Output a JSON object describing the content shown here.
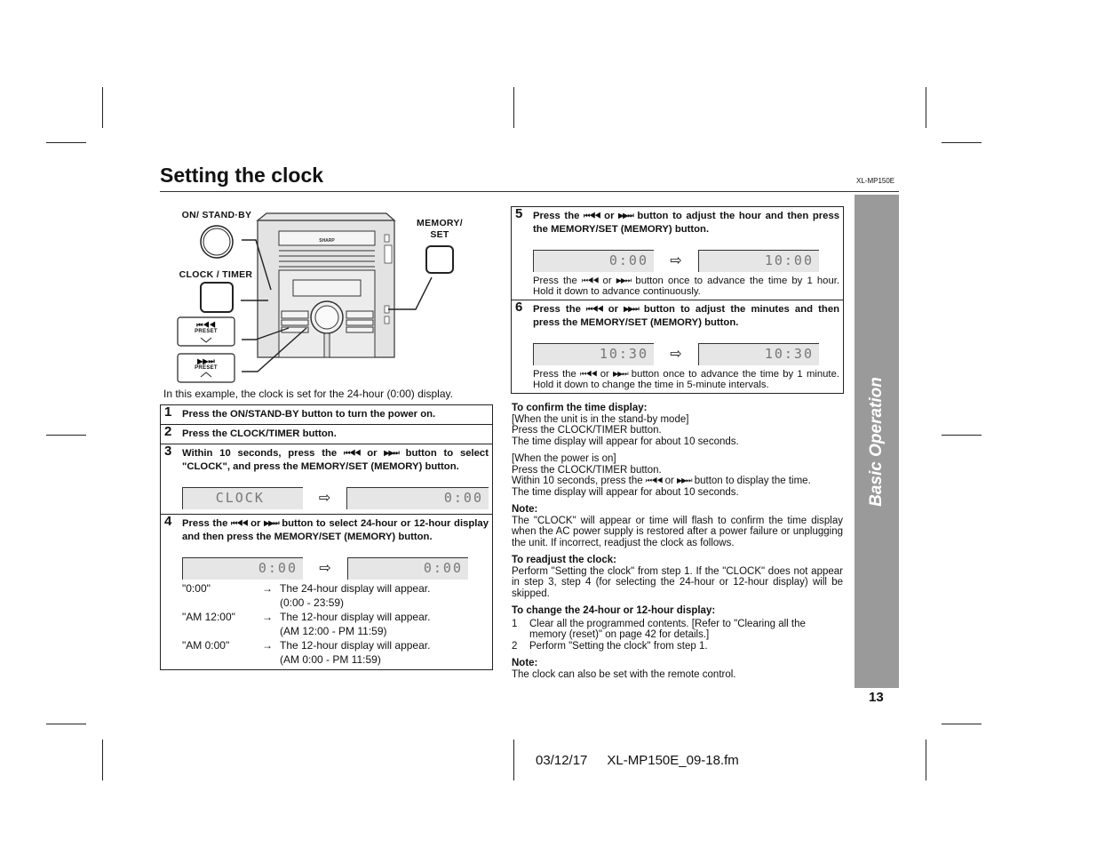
{
  "header": {
    "title": "Setting the clock",
    "model": "XL-MP150E"
  },
  "sidebar": {
    "label": "Basic Operation",
    "color": "#9a9a9a"
  },
  "page_number": "13",
  "footer": {
    "date": "03/12/17",
    "file": "XL-MP150E_09-18.fm"
  },
  "diagram": {
    "labels": {
      "on_standby": "ON/ STAND·BY",
      "clock_timer": "CLOCK / TIMER",
      "memory_set_1": "MEMORY/",
      "memory_set_2": "SET",
      "preset_down": "PRESET",
      "preset_up": "PRESET",
      "brand": "SHARP"
    },
    "caption": "In this example, the clock is set for the 24-hour (0:00) display."
  },
  "icons": {
    "prev": "⏮◀◀",
    "next": "▶▶⏭",
    "arrow_right": "⇨",
    "arrow_small": "→"
  },
  "steps_left": [
    {
      "num": "1",
      "text": "Press the ON/STAND-BY button to turn the power on."
    },
    {
      "num": "2",
      "text": "Press the CLOCK/TIMER button."
    },
    {
      "num": "3",
      "text_a": "Within 10 seconds, press the",
      "text_b": "or",
      "text_c": "button to select \"CLOCK\", and press the MEMORY/SET (MEMORY) button.",
      "lcd_from": "CLOCK",
      "lcd_to": "0:00"
    },
    {
      "num": "4",
      "text_a": "Press the",
      "text_b": "or",
      "text_c": "button to select 24-hour or 12-hour display and then press the MEMORY/SET (MEMORY) button.",
      "lcd_from": "0:00",
      "lcd_to": "0:00",
      "options": [
        {
          "key": "\"0:00\"",
          "line1": "The 24-hour display will appear.",
          "line2": "(0:00 - 23:59)"
        },
        {
          "key": "\"AM 12:00\"",
          "line1": "The 12-hour display will appear.",
          "line2": "(AM 12:00 - PM 11:59)"
        },
        {
          "key": "\"AM 0:00\"",
          "line1": "The 12-hour display will appear.",
          "line2": "(AM 0:00 - PM 11:59)"
        }
      ]
    }
  ],
  "steps_right": [
    {
      "num": "5",
      "text_a": "Press the",
      "text_b": "or",
      "text_c": "button to adjust the hour and then press the MEMORY/SET (MEMORY) button.",
      "lcd_from": "0:00",
      "lcd_to": "10:00",
      "note_a": "Press the",
      "note_b": "or",
      "note_c": "button once to advance the time by 1 hour. Hold it down to advance continuously."
    },
    {
      "num": "6",
      "text_a": "Press the",
      "text_b": "or",
      "text_c": "button to adjust the minutes and then press the MEMORY/SET (MEMORY) button.",
      "lcd_from": "10:30",
      "lcd_to": "10:30",
      "note_a": "Press the",
      "note_b": "or",
      "note_c": "button once to advance the time by 1 minute. Hold it down to change the time in 5-minute intervals."
    }
  ],
  "right_column": {
    "confirm": {
      "heading": "To confirm the time display:",
      "standby_lines": [
        "[When the unit is in the stand-by mode]",
        "Press the CLOCK/TIMER button.",
        "The time display will appear for about 10 seconds."
      ],
      "power_on_1": "[When the power is on]",
      "power_on_2": "Press the CLOCK/TIMER button.",
      "power_on_3a": "Within 10 seconds, press the",
      "power_on_3b": "or",
      "power_on_3c": "button to display the time.",
      "power_on_4": "The time display will appear for about 10 seconds."
    },
    "note1": {
      "heading": "Note:",
      "text": "The \"CLOCK\" will appear or time will flash to confirm the time display when the AC power supply is restored after a power failure or unplugging the unit. If incorrect, readjust the clock as follows."
    },
    "readjust": {
      "heading": "To readjust the clock:",
      "text": "Perform \"Setting the clock\" from step 1. If the \"CLOCK\" does not appear in step 3, step 4 (for selecting the 24-hour or 12-hour display) will be skipped."
    },
    "change": {
      "heading": "To change the 24-hour or 12-hour display:",
      "items": [
        {
          "n": "1",
          "text": "Clear all the programmed contents. [Refer to \"Clearing all the memory (reset)\" on page 42 for details.]"
        },
        {
          "n": "2",
          "text": "Perform \"Setting the clock\" from step 1."
        }
      ]
    },
    "note2": {
      "heading": "Note:",
      "text": "The clock can also be set with the remote control."
    }
  }
}
